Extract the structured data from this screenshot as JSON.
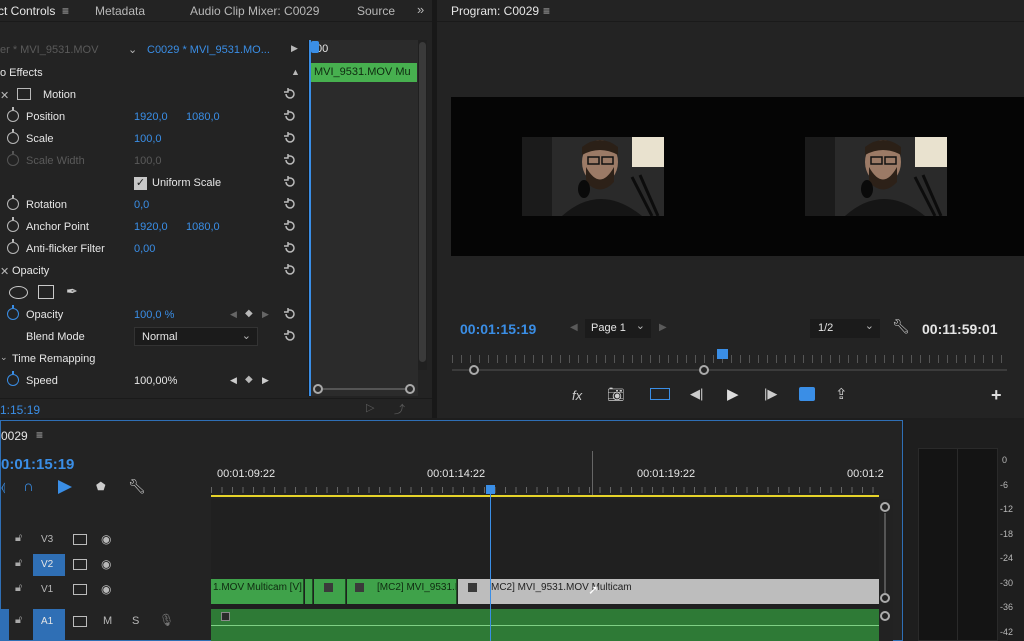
{
  "effect_controls": {
    "tabs": [
      "ct Controls",
      "Metadata",
      "Audio Clip Mixer: C0029",
      "Source"
    ],
    "source_label": "er * MVI_9531.MOV",
    "clip_label": "C0029 * MVI_9531.MO...",
    "mini_time": ":00",
    "mini_clip": "MVI_9531.MOV Mu",
    "section_video": "o Effects",
    "motion": "Motion",
    "position_label": "Position",
    "position_x": "1920,0",
    "position_y": "1080,0",
    "scale_label": "Scale",
    "scale_val": "100,0",
    "scale_width_label": "Scale Width",
    "scale_width_val": "100,0",
    "uniform_scale": "Uniform Scale",
    "rotation_label": "Rotation",
    "rotation_val": "0,0",
    "anchor_label": "Anchor Point",
    "anchor_x": "1920,0",
    "anchor_y": "1080,0",
    "antiflicker_label": "Anti-flicker Filter",
    "antiflicker_val": "0,00",
    "opacity_section": "Opacity",
    "opacity_label": "Opacity",
    "opacity_val": "100,0 %",
    "blend_label": "Blend Mode",
    "blend_val": "Normal",
    "time_remap": "Time Remapping",
    "speed_label": "Speed",
    "speed_val": "100,00%",
    "timecode": "1:15:19"
  },
  "program": {
    "title": "Program: C0029",
    "timecode_left": "00:01:15:19",
    "page": "Page 1",
    "zoom": "1/2",
    "timecode_right": "00:11:59:01",
    "fx": "fx"
  },
  "timeline": {
    "title": "0029",
    "timecode": "0:01:15:19",
    "ruler": [
      "00:01:09:22",
      "00:01:14:22",
      "00:01:19:22",
      "00:01:2"
    ],
    "tracks": [
      "V3",
      "V2",
      "V1",
      "A1"
    ],
    "track_m": "M",
    "track_s": "S",
    "clip1": "1.MOV Multicam [V]",
    "clip2": "[MC2] MVI_9531.M",
    "clip3": "MC2] MVI_9531.MOV Multicam"
  },
  "meter": {
    "ticks": [
      "0",
      "-6",
      "-12",
      "-18",
      "-24",
      "-30",
      "-36",
      "-42"
    ]
  },
  "colors": {
    "accent": "#3a8ee6",
    "clip_green": "#3fa24a",
    "clip_grey": "#bdbdbd",
    "work_area": "#e6d32a"
  }
}
